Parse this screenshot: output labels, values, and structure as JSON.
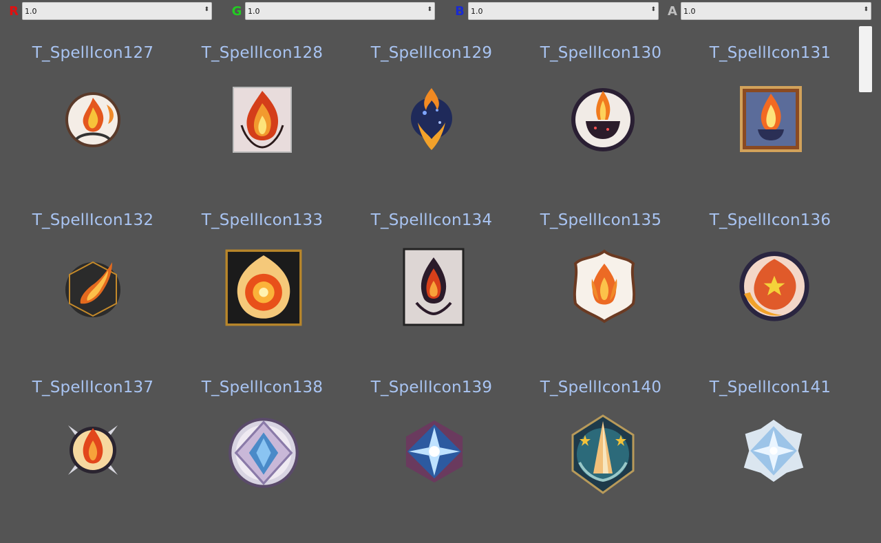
{
  "channels": [
    {
      "letter": "R",
      "value": "1.0",
      "color": "#e01010"
    },
    {
      "letter": "G",
      "value": "1.0",
      "color": "#22cc22"
    },
    {
      "letter": "B",
      "value": "1.0",
      "color": "#1a2bd0"
    },
    {
      "letter": "A",
      "value": "1.0",
      "color": "#bfbfbf"
    }
  ],
  "stepper_glyph": "⬍",
  "assets": [
    {
      "name": "T_SpellIcon127",
      "icon": "fire-emblem-round-icon"
    },
    {
      "name": "T_SpellIcon128",
      "icon": "fire-card-icon"
    },
    {
      "name": "T_SpellIcon129",
      "icon": "fire-orb-icon"
    },
    {
      "name": "T_SpellIcon130",
      "icon": "fire-cauldron-icon"
    },
    {
      "name": "T_SpellIcon131",
      "icon": "fire-framed-icon"
    },
    {
      "name": "T_SpellIcon132",
      "icon": "fire-comet-hexagon-icon"
    },
    {
      "name": "T_SpellIcon133",
      "icon": "fire-sun-square-icon"
    },
    {
      "name": "T_SpellIcon134",
      "icon": "dark-flame-card-icon"
    },
    {
      "name": "T_SpellIcon135",
      "icon": "fire-ornate-frame-icon"
    },
    {
      "name": "T_SpellIcon136",
      "icon": "fire-star-disc-icon"
    },
    {
      "name": "T_SpellIcon137",
      "icon": "fire-compass-icon"
    },
    {
      "name": "T_SpellIcon138",
      "icon": "ice-diamond-ring-icon"
    },
    {
      "name": "T_SpellIcon139",
      "icon": "ice-star-gem-icon"
    },
    {
      "name": "T_SpellIcon140",
      "icon": "ice-spire-badge-icon"
    },
    {
      "name": "T_SpellIcon141",
      "icon": "ice-crystal-star-icon"
    }
  ]
}
